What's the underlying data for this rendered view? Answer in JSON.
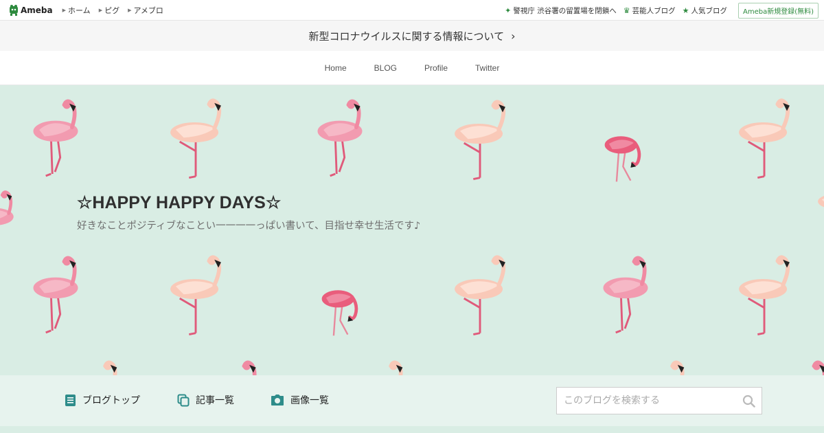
{
  "global_header": {
    "logo_text": "Ameba",
    "nav": [
      "ホーム",
      "ピグ",
      "アメブロ"
    ],
    "right_links": [
      {
        "icon": "sparkle-icon",
        "label": "警視庁 渋谷署の留置場を閉鎖へ"
      },
      {
        "icon": "crown-icon",
        "label": "芸能人ブログ"
      },
      {
        "icon": "star-icon",
        "label": "人気ブログ"
      }
    ],
    "register_label": "Ameba新規登録(無料)"
  },
  "notice": {
    "text": "新型コロナウイルスに関する情報について",
    "chevron": "›"
  },
  "blog_nav": [
    "Home",
    "BLOG",
    "Profile",
    "Twitter"
  ],
  "blog_header": {
    "title": "☆HAPPY HAPPY DAYS☆",
    "description": "好きなことポジティブなことい一一一一っぱい書いて、目指せ幸せ生活です♪",
    "background_color": "#d9ede4"
  },
  "menu": {
    "items": [
      {
        "icon": "document-icon",
        "label": "ブログトップ"
      },
      {
        "icon": "copy-icon",
        "label": "記事一覧"
      },
      {
        "icon": "camera-icon",
        "label": "画像一覧"
      }
    ],
    "search_placeholder": "このブログを検索する"
  },
  "colors": {
    "accent_green": "#2d8a3e",
    "menu_icon_teal": "#2e8c8a",
    "flamingo_pink": "#f08aa2",
    "flamingo_peach": "#f9c9b8"
  }
}
